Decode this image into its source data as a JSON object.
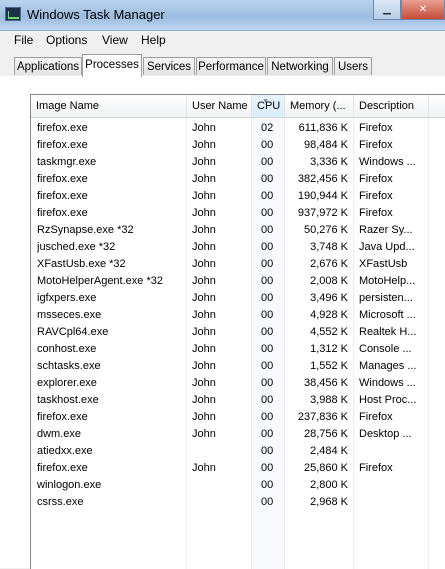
{
  "window": {
    "title": "Windows Task Manager"
  },
  "menu": [
    "File",
    "Options",
    "View",
    "Help"
  ],
  "tabs": [
    "Applications",
    "Processes",
    "Services",
    "Performance",
    "Networking",
    "Users"
  ],
  "active_tab": "Processes",
  "columns": {
    "name": "Image Name",
    "user": "User Name",
    "cpu": "CPU",
    "memory": "Memory (...",
    "description": "Description"
  },
  "processes": [
    {
      "name": "firefox.exe",
      "user": "John",
      "cpu": "02",
      "memory": "611,836 K",
      "description": "Firefox"
    },
    {
      "name": "firefox.exe",
      "user": "John",
      "cpu": "00",
      "memory": "98,484 K",
      "description": "Firefox"
    },
    {
      "name": "taskmgr.exe",
      "user": "John",
      "cpu": "00",
      "memory": "3,336 K",
      "description": "Windows ..."
    },
    {
      "name": "firefox.exe",
      "user": "John",
      "cpu": "00",
      "memory": "382,456 K",
      "description": "Firefox"
    },
    {
      "name": "firefox.exe",
      "user": "John",
      "cpu": "00",
      "memory": "190,944 K",
      "description": "Firefox"
    },
    {
      "name": "firefox.exe",
      "user": "John",
      "cpu": "00",
      "memory": "937,972 K",
      "description": "Firefox"
    },
    {
      "name": "RzSynapse.exe *32",
      "user": "John",
      "cpu": "00",
      "memory": "50,276 K",
      "description": "Razer Sy..."
    },
    {
      "name": "jusched.exe *32",
      "user": "John",
      "cpu": "00",
      "memory": "3,748 K",
      "description": "Java Upd..."
    },
    {
      "name": "XFastUsb.exe *32",
      "user": "John",
      "cpu": "00",
      "memory": "2,676 K",
      "description": "XFastUsb"
    },
    {
      "name": "MotoHelperAgent.exe *32",
      "user": "John",
      "cpu": "00",
      "memory": "2,008 K",
      "description": "MotoHelp..."
    },
    {
      "name": "igfxpers.exe",
      "user": "John",
      "cpu": "00",
      "memory": "3,496 K",
      "description": "persisten..."
    },
    {
      "name": "msseces.exe",
      "user": "John",
      "cpu": "00",
      "memory": "4,928 K",
      "description": "Microsoft ..."
    },
    {
      "name": "RAVCpl64.exe",
      "user": "John",
      "cpu": "00",
      "memory": "4,552 K",
      "description": "Realtek H..."
    },
    {
      "name": "conhost.exe",
      "user": "John",
      "cpu": "00",
      "memory": "1,312 K",
      "description": "Console ..."
    },
    {
      "name": "schtasks.exe",
      "user": "John",
      "cpu": "00",
      "memory": "1,552 K",
      "description": "Manages ..."
    },
    {
      "name": "explorer.exe",
      "user": "John",
      "cpu": "00",
      "memory": "38,456 K",
      "description": "Windows ..."
    },
    {
      "name": "taskhost.exe",
      "user": "John",
      "cpu": "00",
      "memory": "3,988 K",
      "description": "Host Proc..."
    },
    {
      "name": "firefox.exe",
      "user": "John",
      "cpu": "00",
      "memory": "237,836 K",
      "description": "Firefox"
    },
    {
      "name": "dwm.exe",
      "user": "John",
      "cpu": "00",
      "memory": "28,756 K",
      "description": "Desktop ..."
    },
    {
      "name": "atiedxx.exe",
      "user": "",
      "cpu": "00",
      "memory": "2,484 K",
      "description": ""
    },
    {
      "name": "firefox.exe",
      "user": "John",
      "cpu": "00",
      "memory": "25,860 K",
      "description": "Firefox"
    },
    {
      "name": "winlogon.exe",
      "user": "",
      "cpu": "00",
      "memory": "2,800 K",
      "description": ""
    },
    {
      "name": "csrss.exe",
      "user": "",
      "cpu": "00",
      "memory": "2,968 K",
      "description": ""
    }
  ]
}
